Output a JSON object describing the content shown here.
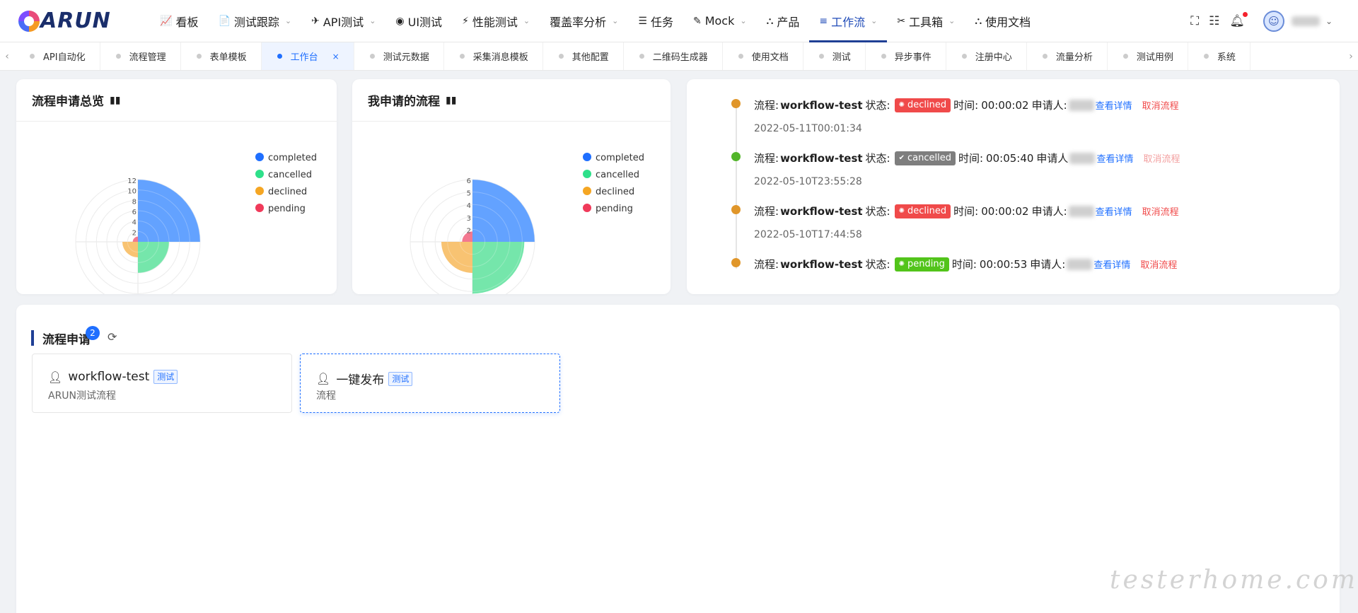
{
  "header": {
    "logo_text": "ARUN",
    "nav": [
      {
        "icon": "📈",
        "label": "看板",
        "chev": false
      },
      {
        "icon": "📄",
        "label": "测试跟踪",
        "chev": true
      },
      {
        "icon": "✈",
        "label": "API测试",
        "chev": true
      },
      {
        "icon": "◉",
        "label": "UI测试",
        "chev": false
      },
      {
        "icon": "⚡",
        "label": "性能测试",
        "chev": true
      },
      {
        "icon": "",
        "label": "覆盖率分析",
        "chev": true
      },
      {
        "icon": "☰",
        "label": "任务",
        "chev": false
      },
      {
        "icon": "✎",
        "label": "Mock",
        "chev": true
      },
      {
        "icon": "⛬",
        "label": "产品",
        "chev": false
      },
      {
        "icon": "≡",
        "label": "工作流",
        "chev": true,
        "active": true
      },
      {
        "icon": "✂",
        "label": "工具箱",
        "chev": true
      },
      {
        "icon": "⛬",
        "label": "使用文档",
        "chev": false
      }
    ]
  },
  "tabs": [
    {
      "label": "API自动化"
    },
    {
      "label": "流程管理"
    },
    {
      "label": "表单模板"
    },
    {
      "label": "工作台",
      "active": true
    },
    {
      "label": "测试元数据"
    },
    {
      "label": "采集消息模板"
    },
    {
      "label": "其他配置"
    },
    {
      "label": "二维码生成器"
    },
    {
      "label": "使用文档"
    },
    {
      "label": "测试"
    },
    {
      "label": "异步事件"
    },
    {
      "label": "注册中心"
    },
    {
      "label": "流量分析"
    },
    {
      "label": "测试用例"
    },
    {
      "label": "系统"
    }
  ],
  "overview_card": {
    "title": "流程申请总览"
  },
  "mine_card": {
    "title": "我申请的流程"
  },
  "legend": [
    {
      "label": "completed",
      "color": "#1f6fff"
    },
    {
      "label": "cancelled",
      "color": "#2ee08a"
    },
    {
      "label": "declined",
      "color": "#f5a623"
    },
    {
      "label": "pending",
      "color": "#f03a5a"
    }
  ],
  "chart_data": [
    {
      "type": "pie",
      "title": "流程申请总览",
      "subtype": "nightingale-rose",
      "labels": [
        "completed",
        "cancelled",
        "declined",
        "pending"
      ],
      "values": [
        12,
        6,
        3,
        1
      ],
      "radial_ticks": [
        "12",
        "10",
        "8",
        "6",
        "4",
        "2"
      ],
      "legend_position": "right"
    },
    {
      "type": "pie",
      "title": "我申请的流程",
      "subtype": "nightingale-rose",
      "labels": [
        "completed",
        "cancelled",
        "declined",
        "pending"
      ],
      "values": [
        6,
        5,
        3,
        1
      ],
      "radial_ticks": [
        "6",
        "5",
        "4",
        "3",
        "2"
      ],
      "legend_position": "right"
    }
  ],
  "timeline": [
    {
      "dot_color": "#e0962a",
      "prefix": "流程:",
      "name": "workflow-test",
      "status_label": "状态:",
      "status": "declined",
      "time_label": "时间:",
      "duration": "00:00:02",
      "applicant_label": "申请人:",
      "detail": "查看详情",
      "cancel": "取消流程",
      "cancel_dim": false,
      "timestamp": "2022-05-11T00:01:34"
    },
    {
      "dot_color": "#52b52a",
      "prefix": "流程:",
      "name": "workflow-test",
      "status_label": "状态:",
      "status": "cancelled",
      "time_label": "时间:",
      "duration": "00:05:40",
      "applicant_label": "申请人",
      "detail": "查看详情",
      "cancel": "取消流程",
      "cancel_dim": true,
      "timestamp": "2022-05-10T23:55:28"
    },
    {
      "dot_color": "#e0962a",
      "prefix": "流程:",
      "name": "workflow-test",
      "status_label": "状态:",
      "status": "declined",
      "time_label": "时间:",
      "duration": "00:00:02",
      "applicant_label": "申请人:",
      "detail": "查看详情",
      "cancel": "取消流程",
      "cancel_dim": false,
      "timestamp": "2022-05-10T17:44:58"
    },
    {
      "dot_color": "#e0962a",
      "prefix": "流程:",
      "name": "workflow-test",
      "status_label": "状态:",
      "status": "pending",
      "time_label": "时间:",
      "duration": "00:00:53",
      "applicant_label": "申请人:",
      "detail": "查看详情",
      "cancel": "取消流程",
      "cancel_dim": false,
      "timestamp": ""
    }
  ],
  "flow_section": {
    "title": "流程申请",
    "count": "2",
    "cards": [
      {
        "name": "workflow-test",
        "tag": "测试",
        "desc": "ARUN测试流程"
      },
      {
        "name": "一键发布",
        "tag": "测试",
        "desc": "流程"
      }
    ]
  },
  "watermark": "testerhome.com"
}
